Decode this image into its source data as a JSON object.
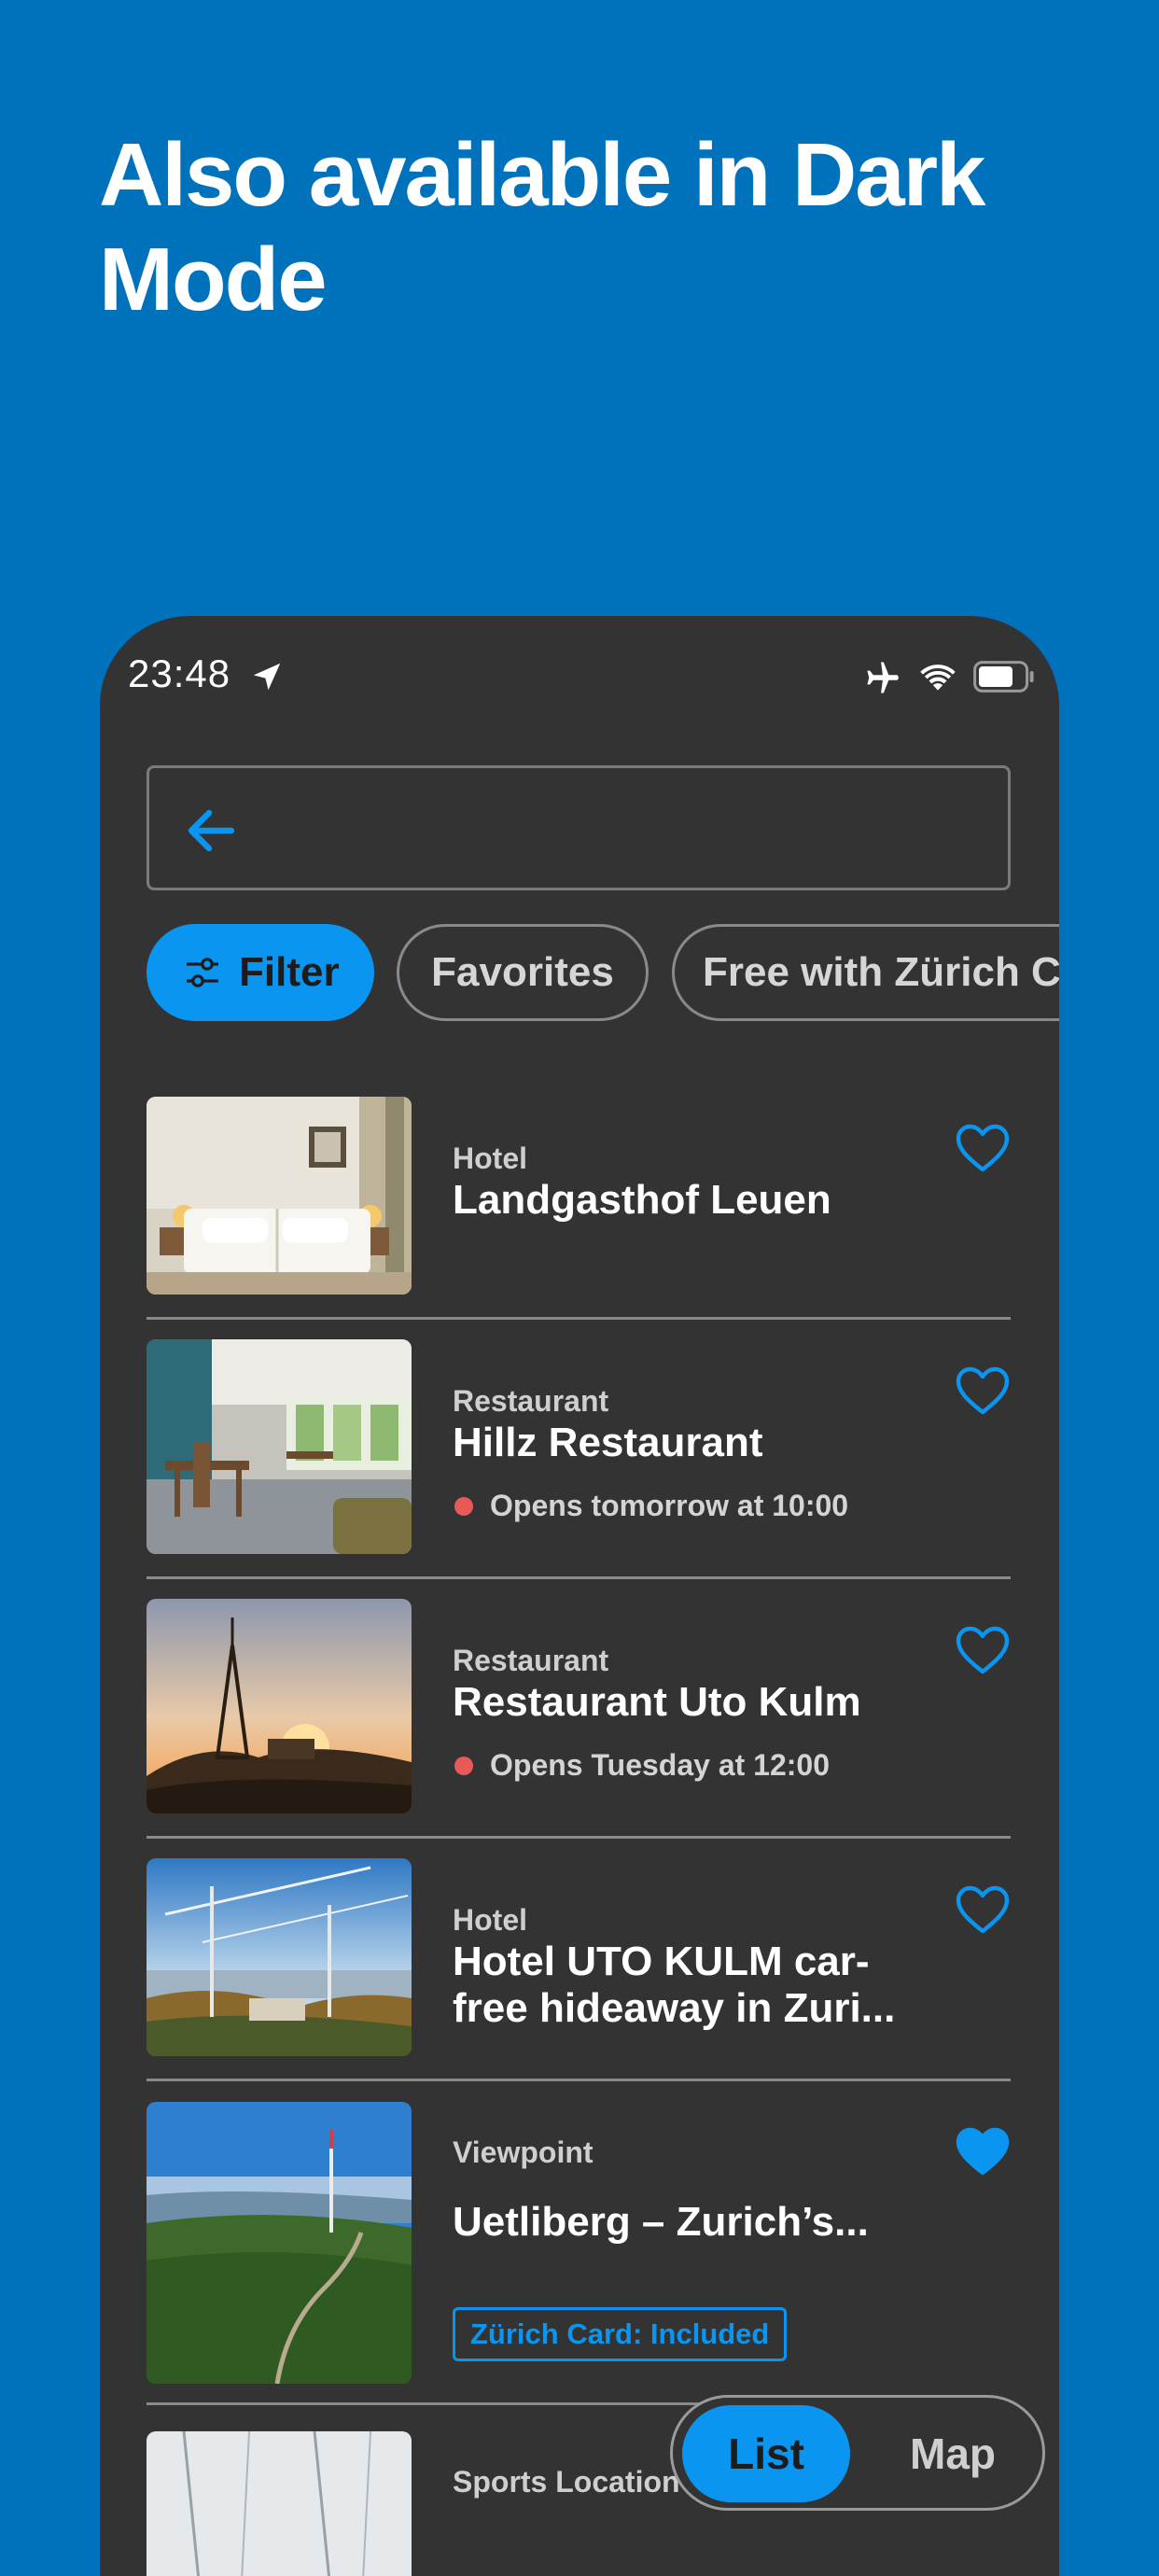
{
  "headline": "Also available in Dark Mode",
  "status_bar": {
    "time": "23:48"
  },
  "search": {
    "value": ""
  },
  "chips": [
    {
      "label": "Filter",
      "active": true
    },
    {
      "label": "Favorites",
      "active": false
    },
    {
      "label": "Free with Zürich C",
      "active": false
    }
  ],
  "items": [
    {
      "category": "Hotel",
      "title": "Landgasthof Leuen",
      "favorite": false
    },
    {
      "category": "Restaurant",
      "title": "Hillz Restaurant",
      "status": "Opens tomorrow at 10:00",
      "favorite": false
    },
    {
      "category": "Restaurant",
      "title": "Restaurant Uto Kulm",
      "status": "Opens Tuesday at 12:00",
      "favorite": false
    },
    {
      "category": "Hotel",
      "title": "Hotel UTO KULM car-free hideaway in Zuri...",
      "favorite": false
    },
    {
      "category": "Viewpoint",
      "title": "Uetliberg – Zurich’s...",
      "badge": "Zürich Card: Included",
      "favorite": true
    },
    {
      "category": "Sports Location"
    }
  ],
  "view_toggle": {
    "list_label": "List",
    "map_label": "Map",
    "selected": "List"
  },
  "colors": {
    "accent": "#0A96F0",
    "background": "#0072BC",
    "surface": "#333333",
    "closed_dot": "#E85A5A"
  }
}
